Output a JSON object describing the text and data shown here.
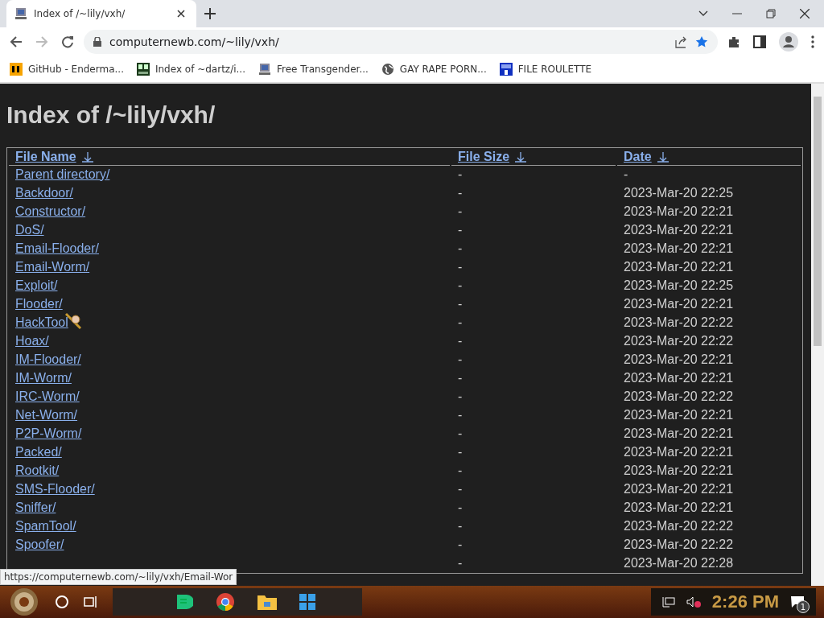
{
  "browser": {
    "tab": {
      "title": "Index of /~lily/vxh/",
      "selected": true
    },
    "address": "computernewb.com/~lily/vxh/",
    "bookmarks": [
      {
        "label": "GitHub - Enderma..."
      },
      {
        "label": "Index of ~dartz/i..."
      },
      {
        "label": "Free Transgender..."
      },
      {
        "label": "GAY RAPE PORN..."
      },
      {
        "label": "FILE ROULETTE"
      }
    ]
  },
  "page": {
    "heading": "Index of /~lily/vxh/",
    "table": {
      "columns": [
        "File Name",
        "File Size",
        "Date"
      ],
      "rows": [
        {
          "name": "Parent directory/",
          "size": "-",
          "date": "-"
        },
        {
          "name": "Backdoor/",
          "size": "-",
          "date": "2023-Mar-20 22:25"
        },
        {
          "name": "Constructor/",
          "size": "-",
          "date": "2023-Mar-20 22:21"
        },
        {
          "name": "DoS/",
          "size": "-",
          "date": "2023-Mar-20 22:21"
        },
        {
          "name": "Email-Flooder/",
          "size": "-",
          "date": "2023-Mar-20 22:21"
        },
        {
          "name": "Email-Worm/",
          "size": "-",
          "date": "2023-Mar-20 22:21"
        },
        {
          "name": "Exploit/",
          "size": "-",
          "date": "2023-Mar-20 22:25"
        },
        {
          "name": "Flooder/",
          "size": "-",
          "date": "2023-Mar-20 22:21"
        },
        {
          "name": "HackTool",
          "size": "-",
          "date": "2023-Mar-20 22:22"
        },
        {
          "name": "Hoax/",
          "size": "-",
          "date": "2023-Mar-20 22:22"
        },
        {
          "name": "IM-Flooder/",
          "size": "-",
          "date": "2023-Mar-20 22:21"
        },
        {
          "name": "IM-Worm/",
          "size": "-",
          "date": "2023-Mar-20 22:21"
        },
        {
          "name": "IRC-Worm/",
          "size": "-",
          "date": "2023-Mar-20 22:22"
        },
        {
          "name": "Net-Worm/",
          "size": "-",
          "date": "2023-Mar-20 22:21"
        },
        {
          "name": "P2P-Worm/",
          "size": "-",
          "date": "2023-Mar-20 22:21"
        },
        {
          "name": "Packed/",
          "size": "-",
          "date": "2023-Mar-20 22:21"
        },
        {
          "name": "Rootkit/",
          "size": "-",
          "date": "2023-Mar-20 22:21"
        },
        {
          "name": "SMS-Flooder/",
          "size": "-",
          "date": "2023-Mar-20 22:21"
        },
        {
          "name": "Sniffer/",
          "size": "-",
          "date": "2023-Mar-20 22:21"
        },
        {
          "name": "SpamTool/",
          "size": "-",
          "date": "2023-Mar-20 22:22"
        },
        {
          "name": "Spoofer/",
          "size": "-",
          "date": "2023-Mar-20 22:22"
        },
        {
          "size": "-",
          "date": "2023-Mar-20 22:28"
        }
      ]
    },
    "status_url": "https://computernewb.com/~lily/vxh/Email-Wor"
  },
  "taskbar": {
    "clock": "2:26 PM",
    "notifications": "1"
  }
}
